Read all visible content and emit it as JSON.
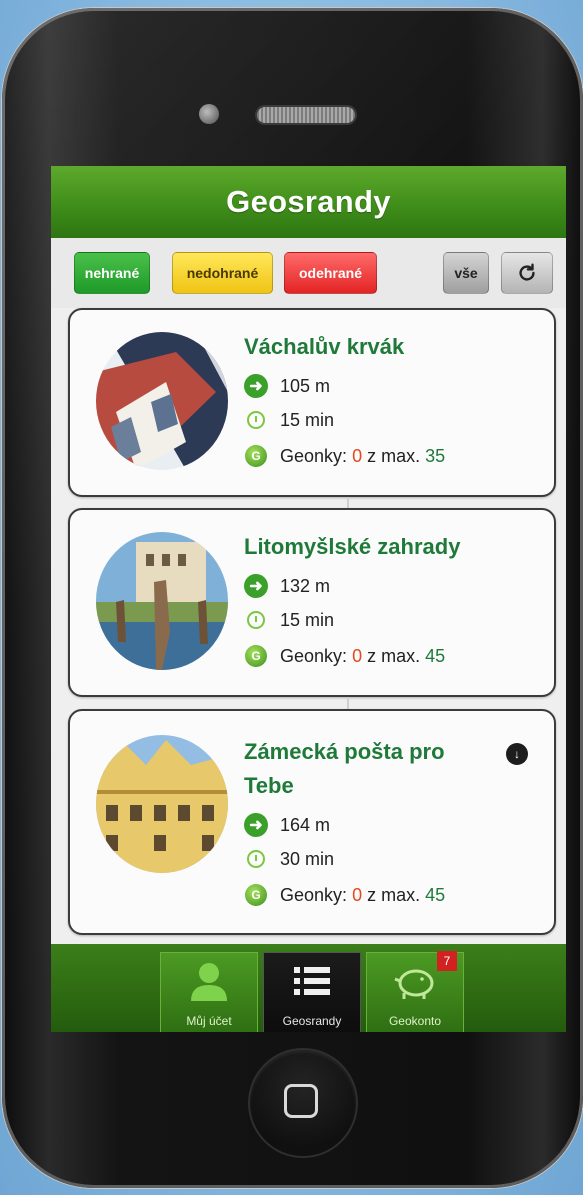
{
  "app": {
    "title": "Geosrandy"
  },
  "filters": {
    "unplayed": "nehrané",
    "unfinished": "nedohrané",
    "played": "odehrané",
    "all": "vše",
    "refresh_icon": "refresh-icon"
  },
  "routes": [
    {
      "name": "Váchalův krvák",
      "name_line2": "",
      "distance": "105 m",
      "duration": "15 min",
      "geonky_label": "Geonky:",
      "geonky": "0",
      "of_max": "z max.",
      "max": "35",
      "downloadable": false
    },
    {
      "name": "Litomyšlské zahrady",
      "name_line2": "",
      "distance": "132 m",
      "duration": "15 min",
      "geonky_label": "Geonky:",
      "geonky": "0",
      "of_max": "z max.",
      "max": "45",
      "downloadable": false
    },
    {
      "name": "Zámecká pošta pro",
      "name_line2": "Tebe",
      "distance": "164 m",
      "duration": "30 min",
      "geonky_label": "Geonky:",
      "geonky": "0",
      "of_max": "z max.",
      "max": "45",
      "downloadable": true
    }
  ],
  "nav": {
    "account": "Můj účet",
    "routes": "Geosrandy",
    "geokonto": "Geokonto",
    "geokonto_badge": "7",
    "active": "routes"
  },
  "colors": {
    "header_green": "#3f8e1a",
    "title_green": "#1f7a3a",
    "accent_red": "#e24a1f"
  }
}
